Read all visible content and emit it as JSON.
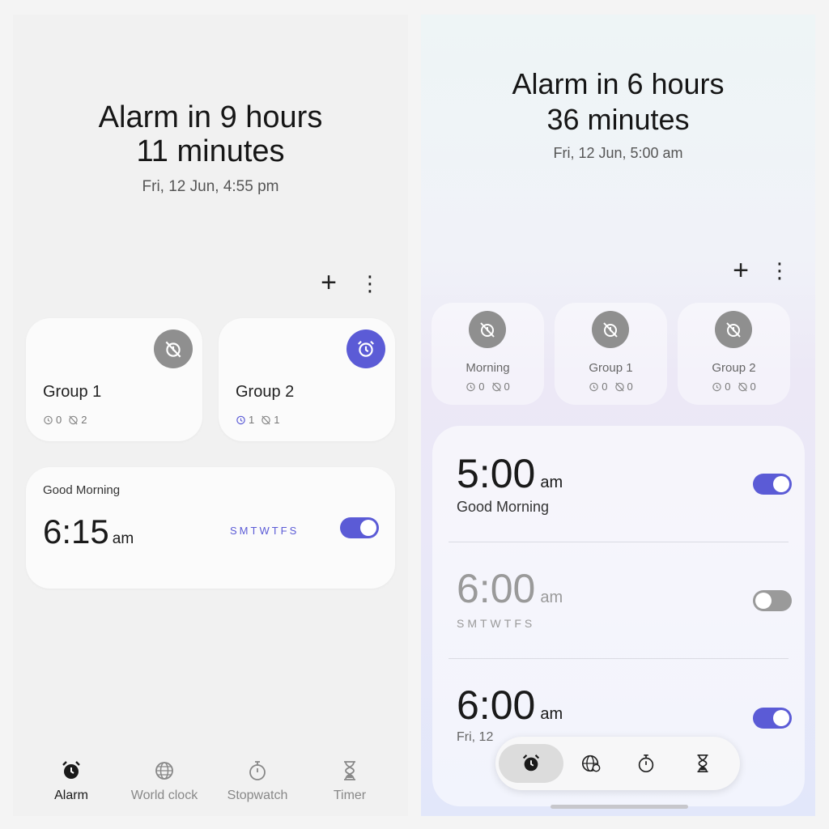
{
  "left": {
    "headline_line1": "Alarm in 9 hours",
    "headline_line2": "11 minutes",
    "next_alarm": "Fri, 12 Jun, 4:55 pm",
    "add_icon": "plus-icon",
    "more_icon": "more-vertical-icon",
    "groups": [
      {
        "name": "Group 1",
        "on_count": "0",
        "off_count": "2",
        "badge_color": "#8f8f8f",
        "badge_icon": "alarm-off-icon"
      },
      {
        "name": "Group 2",
        "on_count": "1",
        "off_count": "1",
        "badge_color": "#5b5bd6",
        "badge_icon": "alarm-clock-icon"
      }
    ],
    "alarm": {
      "label": "Good Morning",
      "time": "6:15",
      "ampm": "am",
      "days": "SMTWTFS",
      "enabled": true
    },
    "tabs": [
      {
        "label": "Alarm",
        "icon": "alarm-clock-icon",
        "active": true
      },
      {
        "label": "World clock",
        "icon": "globe-icon",
        "active": false
      },
      {
        "label": "Stopwatch",
        "icon": "stopwatch-icon",
        "active": false
      },
      {
        "label": "Timer",
        "icon": "hourglass-icon",
        "active": false
      }
    ]
  },
  "right": {
    "headline_line1": "Alarm in 6 hours",
    "headline_line2": "36 minutes",
    "next_alarm": "Fri, 12 Jun, 5:00 am",
    "groups": [
      {
        "name": "Morning",
        "on_count": "0",
        "off_count": "0"
      },
      {
        "name": "Group 1",
        "on_count": "0",
        "off_count": "0"
      },
      {
        "name": "Group 2",
        "on_count": "0",
        "off_count": "0"
      }
    ],
    "alarms": [
      {
        "time": "5:00",
        "ampm": "am",
        "label": "Good Morning",
        "enabled": true
      },
      {
        "time": "6:00",
        "ampm": "am",
        "days": "SMTWTFS",
        "enabled": false
      },
      {
        "time": "6:00",
        "ampm": "am",
        "date": "Fri, 12",
        "enabled": true
      }
    ],
    "nav_icons": [
      "alarm-clock-icon",
      "globe-icon",
      "stopwatch-icon",
      "hourglass-icon"
    ]
  },
  "colors": {
    "accent": "#5b5bd6",
    "badge_gray": "#8f8f8f",
    "toggle_off": "#9a9a9a"
  }
}
